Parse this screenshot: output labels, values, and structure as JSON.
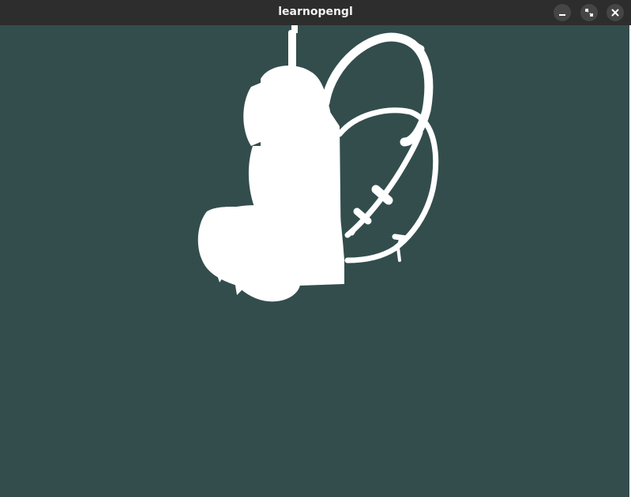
{
  "window": {
    "title": "learnopengl",
    "controls": {
      "minimize": "minimize-icon",
      "maximize": "maximize-icon",
      "close": "close-icon"
    }
  },
  "viewport": {
    "clear_color": "#334d4d",
    "model_color": "#ffffff"
  }
}
